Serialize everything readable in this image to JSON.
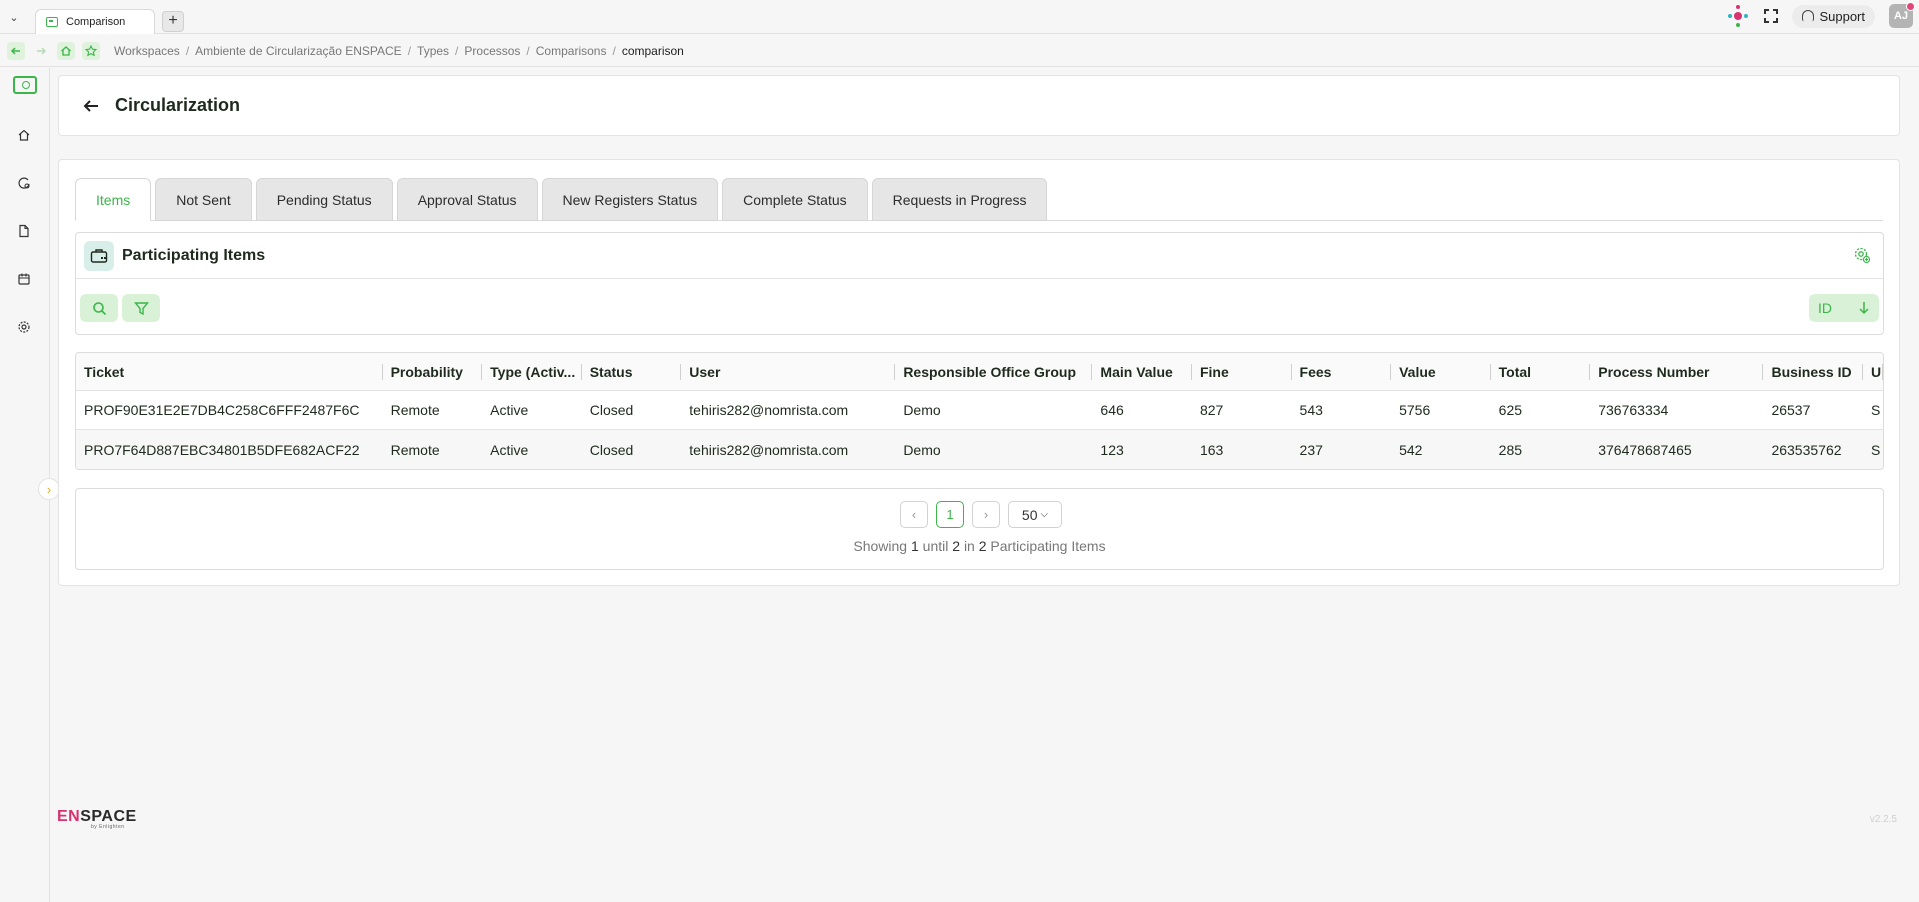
{
  "browser": {
    "tab_title": "Comparison",
    "new_tab": "+",
    "support_label": "Support",
    "avatar_initials": "AJ"
  },
  "breadcrumb": {
    "items": [
      "Workspaces",
      "Ambiente de Circularização ENSPACE",
      "Types",
      "Processos",
      "Comparisons"
    ],
    "current": "comparison"
  },
  "page": {
    "title": "Circularization"
  },
  "tabs": [
    "Items",
    "Not Sent",
    "Pending Status",
    "Approval Status",
    "New Registers Status",
    "Complete Status",
    "Requests in Progress"
  ],
  "panel": {
    "title": "Participating Items",
    "sort_label": "ID"
  },
  "table": {
    "columns": [
      "Ticket",
      "Probability",
      "Type (Activ...",
      "Status",
      "User",
      "Responsible Office Group",
      "Main Value",
      "Fine",
      "Fees",
      "Value",
      "Total",
      "Process Number",
      "Business ID",
      "U"
    ],
    "rows": [
      [
        "PROF90E31E2E7DB4C258C6FFF2487F6C",
        "Remote",
        "Active",
        "Closed",
        "tehiris282@nomrista.com",
        "Demo",
        "646",
        "827",
        "543",
        "5756",
        "625",
        "736763334",
        "26537",
        "S"
      ],
      [
        "PRO7F64D887EBC34801B5DFE682ACF22",
        "Remote",
        "Active",
        "Closed",
        "tehiris282@nomrista.com",
        "Demo",
        "123",
        "163",
        "237",
        "542",
        "285",
        "376478687465",
        "263535762",
        "S"
      ]
    ]
  },
  "pagination": {
    "current_page": "1",
    "page_size": "50",
    "info_prefix": "Showing",
    "info_from": "1",
    "info_until_word": "until",
    "info_to": "2",
    "info_in_word": "in",
    "info_total": "2",
    "info_suffix": "Participating Items"
  },
  "footer": {
    "brand_en": "EN",
    "brand_space": "SPACE",
    "brand_by": "by Enlighten",
    "version": "v2.2.5"
  },
  "colors": {
    "accent": "#3cb64a",
    "brand_pink": "#d7336f"
  }
}
